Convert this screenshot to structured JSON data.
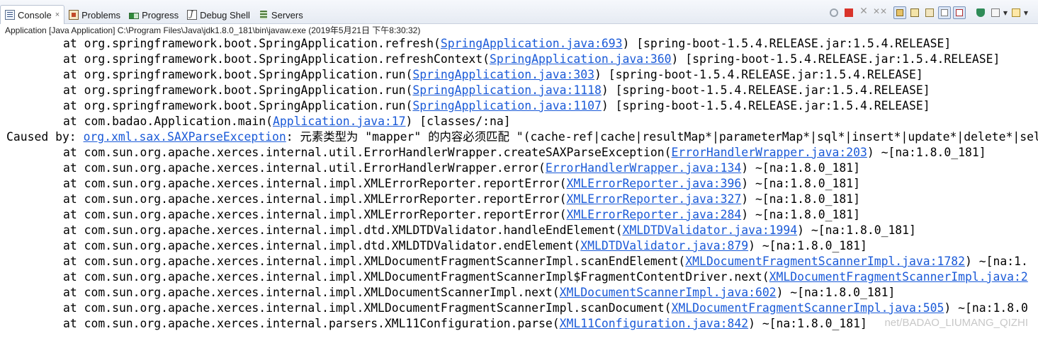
{
  "tabs": [
    {
      "label": "Console",
      "icon": "console-icon",
      "active": true,
      "close": "×"
    },
    {
      "label": "Problems",
      "icon": "problems-icon"
    },
    {
      "label": "Progress",
      "icon": "progress-icon"
    },
    {
      "label": "Debug Shell",
      "icon": "debug-shell-icon"
    },
    {
      "label": "Servers",
      "icon": "servers-icon"
    }
  ],
  "process_label": "Application [Java Application] C:\\Program Files\\Java\\jdk1.8.0_181\\bin\\javaw.exe (2019年5月21日 下午8:30:32)",
  "link_color": "#1a5ad8",
  "lines": [
    {
      "pre": "at org.springframework.boot.SpringApplication.refresh(",
      "link": "SpringApplication.java:693",
      "post": ") [spring-boot-1.5.4.RELEASE.jar:1.5.4.RELEASE]"
    },
    {
      "pre": "at org.springframework.boot.SpringApplication.refreshContext(",
      "link": "SpringApplication.java:360",
      "post": ") [spring-boot-1.5.4.RELEASE.jar:1.5.4.RELEASE]"
    },
    {
      "pre": "at org.springframework.boot.SpringApplication.run(",
      "link": "SpringApplication.java:303",
      "post": ") [spring-boot-1.5.4.RELEASE.jar:1.5.4.RELEASE]"
    },
    {
      "pre": "at org.springframework.boot.SpringApplication.run(",
      "link": "SpringApplication.java:1118",
      "post": ") [spring-boot-1.5.4.RELEASE.jar:1.5.4.RELEASE]"
    },
    {
      "pre": "at org.springframework.boot.SpringApplication.run(",
      "link": "SpringApplication.java:1107",
      "post": ") [spring-boot-1.5.4.RELEASE.jar:1.5.4.RELEASE]"
    },
    {
      "pre": "at com.badao.Application.main(",
      "link": "Application.java:17",
      "post": ") [classes/:na]"
    },
    {
      "pre": "Caused by: ",
      "link": "org.xml.sax.SAXParseException",
      "post": ": 元素类型为 \"mapper\" 的内容必须匹配 \"(cache-ref|cache|resultMap*|parameterMap*|sql*|insert*|update*|delete*|sele",
      "caused": true
    },
    {
      "pre": "at com.sun.org.apache.xerces.internal.util.ErrorHandlerWrapper.createSAXParseException(",
      "link": "ErrorHandlerWrapper.java:203",
      "post": ") ~[na:1.8.0_181]"
    },
    {
      "pre": "at com.sun.org.apache.xerces.internal.util.ErrorHandlerWrapper.error(",
      "link": "ErrorHandlerWrapper.java:134",
      "post": ") ~[na:1.8.0_181]"
    },
    {
      "pre": "at com.sun.org.apache.xerces.internal.impl.XMLErrorReporter.reportError(",
      "link": "XMLErrorReporter.java:396",
      "post": ") ~[na:1.8.0_181]"
    },
    {
      "pre": "at com.sun.org.apache.xerces.internal.impl.XMLErrorReporter.reportError(",
      "link": "XMLErrorReporter.java:327",
      "post": ") ~[na:1.8.0_181]"
    },
    {
      "pre": "at com.sun.org.apache.xerces.internal.impl.XMLErrorReporter.reportError(",
      "link": "XMLErrorReporter.java:284",
      "post": ") ~[na:1.8.0_181]"
    },
    {
      "pre": "at com.sun.org.apache.xerces.internal.impl.dtd.XMLDTDValidator.handleEndElement(",
      "link": "XMLDTDValidator.java:1994",
      "post": ") ~[na:1.8.0_181]"
    },
    {
      "pre": "at com.sun.org.apache.xerces.internal.impl.dtd.XMLDTDValidator.endElement(",
      "link": "XMLDTDValidator.java:879",
      "post": ") ~[na:1.8.0_181]"
    },
    {
      "pre": "at com.sun.org.apache.xerces.internal.impl.XMLDocumentFragmentScannerImpl.scanEndElement(",
      "link": "XMLDocumentFragmentScannerImpl.java:1782",
      "post": ") ~[na:1."
    },
    {
      "pre": "at com.sun.org.apache.xerces.internal.impl.XMLDocumentFragmentScannerImpl$FragmentContentDriver.next(",
      "link": "XMLDocumentFragmentScannerImpl.java:2",
      "post": ""
    },
    {
      "pre": "at com.sun.org.apache.xerces.internal.impl.XMLDocumentScannerImpl.next(",
      "link": "XMLDocumentScannerImpl.java:602",
      "post": ") ~[na:1.8.0_181]"
    },
    {
      "pre": "at com.sun.org.apache.xerces.internal.impl.XMLDocumentFragmentScannerImpl.scanDocument(",
      "link": "XMLDocumentFragmentScannerImpl.java:505",
      "post": ") ~[na:1.8.0"
    },
    {
      "pre": "at com.sun.org.apache.xerces.internal.parsers.XML11Configuration.parse(",
      "link": "XML11Configuration.java:842",
      "post": ") ~[na:1.8.0_181]"
    }
  ],
  "watermark": "net/BADAO_LIUMANG_QIZHI"
}
